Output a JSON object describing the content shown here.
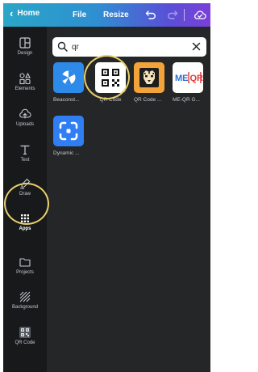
{
  "topbar": {
    "home_label": "Home",
    "file_label": "File",
    "resize_label": "Resize"
  },
  "sidebar": {
    "items": [
      {
        "label": "Design",
        "icon": "design-icon"
      },
      {
        "label": "Elements",
        "icon": "elements-icon"
      },
      {
        "label": "Uploads",
        "icon": "uploads-icon"
      },
      {
        "label": "Text",
        "icon": "text-icon"
      },
      {
        "label": "Draw",
        "icon": "draw-icon"
      },
      {
        "label": "Apps",
        "icon": "apps-icon"
      },
      {
        "label": "Projects",
        "icon": "projects-icon"
      },
      {
        "label": "Background",
        "icon": "background-icon"
      },
      {
        "label": "QR Code",
        "icon": "qr-code-icon"
      }
    ]
  },
  "search": {
    "value": "qr",
    "placeholder": ""
  },
  "apps": [
    {
      "name": "Beaconst...",
      "color": "#2d8ae8"
    },
    {
      "name": "QR Code",
      "color": "#ffffff"
    },
    {
      "name": "QR Code ...",
      "color": "#f2a33a"
    },
    {
      "name": "ME-QR G...",
      "color": "#ffffff"
    },
    {
      "name": "Dynamic ...",
      "color": "#2f7ef3"
    }
  ],
  "logo_text": {
    "meqr": "ME QR"
  },
  "colors": {
    "highlight_circle": "#e8cf69",
    "sidebar_bg": "#18191b",
    "panel_bg": "#252627"
  }
}
